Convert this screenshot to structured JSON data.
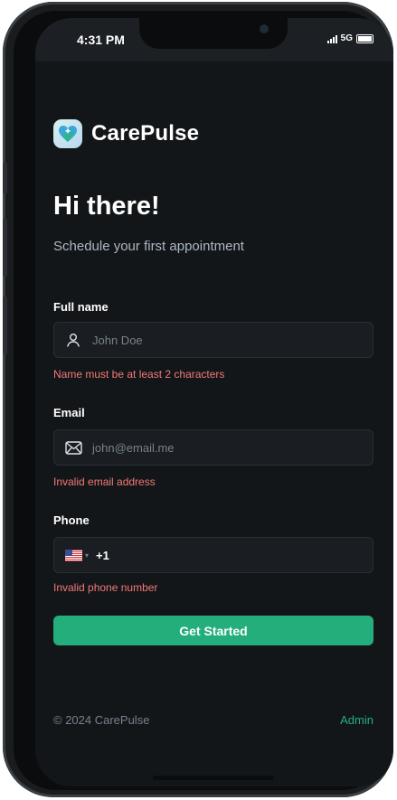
{
  "status_bar": {
    "time": "4:31 PM",
    "network": "5G"
  },
  "brand": {
    "name": "CarePulse",
    "logo_icon": "heart-plus-icon"
  },
  "hero": {
    "title": "Hi there!",
    "subtitle": "Schedule your first appointment"
  },
  "form": {
    "full_name": {
      "label": "Full name",
      "placeholder": "John Doe",
      "error": "Name must be at least 2 characters",
      "icon": "user-icon"
    },
    "email": {
      "label": "Email",
      "placeholder": "john@email.me",
      "error": "Invalid email address",
      "icon": "mail-icon"
    },
    "phone": {
      "label": "Phone",
      "country_code": "+1",
      "country_flag": "us-flag-icon",
      "error": "Invalid phone number"
    }
  },
  "cta": {
    "label": "Get Started"
  },
  "footer": {
    "copyright": "© 2024 CarePulse",
    "admin_link": "Admin"
  },
  "colors": {
    "background": "#131619",
    "accent": "#24ae7c",
    "error": "#f37877",
    "muted": "#76828d"
  }
}
